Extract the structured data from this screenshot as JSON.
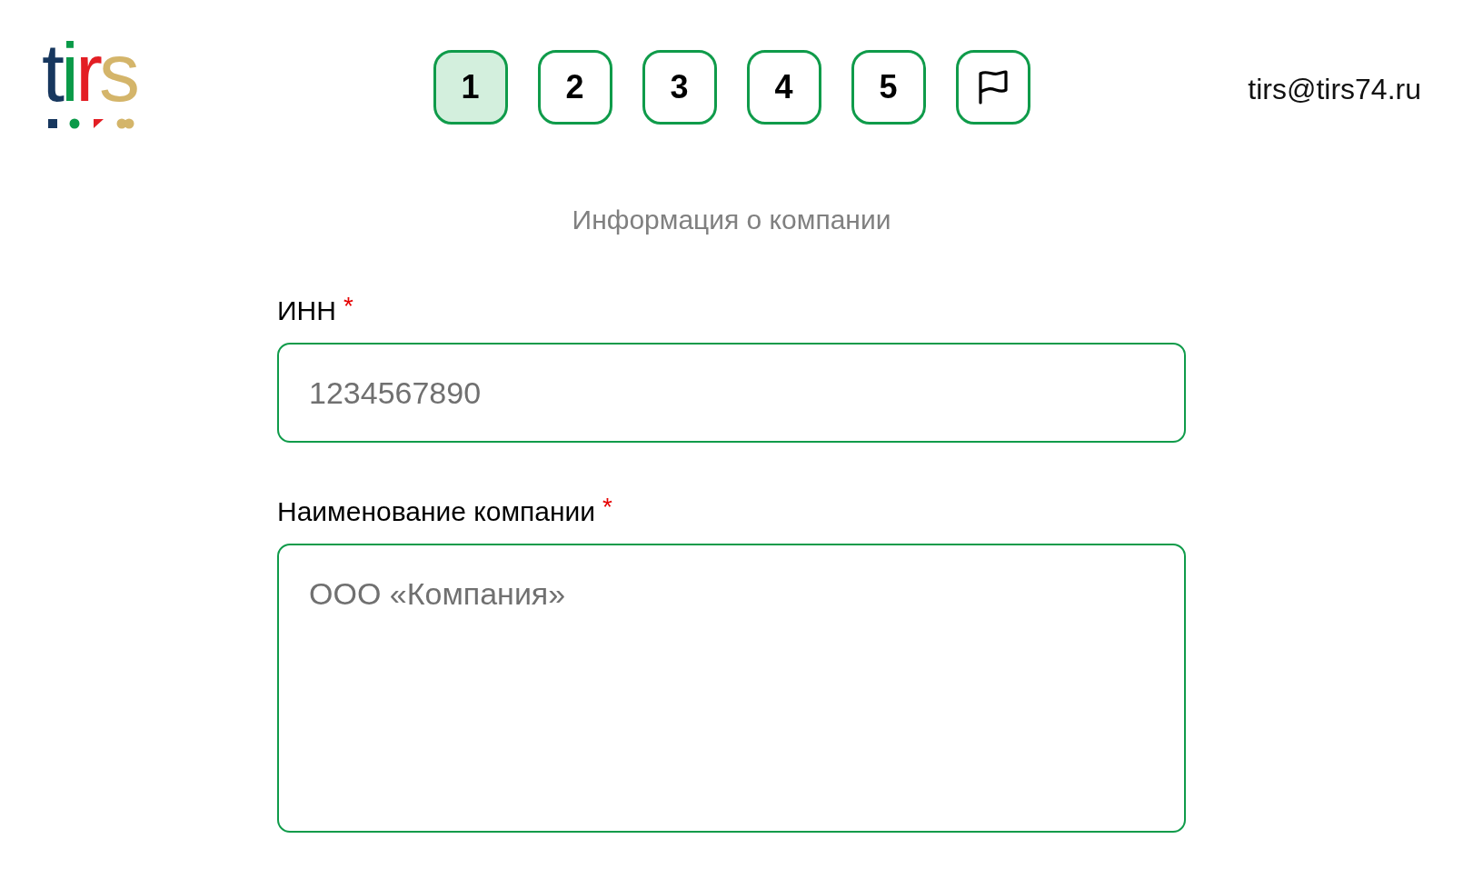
{
  "logo": {
    "text": "tirs"
  },
  "steps": [
    {
      "kind": "number",
      "label": "1",
      "selected": true
    },
    {
      "kind": "number",
      "label": "2",
      "selected": false
    },
    {
      "kind": "number",
      "label": "3",
      "selected": false
    },
    {
      "kind": "number",
      "label": "4",
      "selected": false
    },
    {
      "kind": "number",
      "label": "5",
      "selected": false
    },
    {
      "kind": "flag",
      "selected": false
    }
  ],
  "email": "tirs@tirs74.ru",
  "section_title": "Информация о компании",
  "fields": [
    {
      "kind": "input",
      "label": "ИНН",
      "required_mark": "*",
      "placeholder": "1234567890"
    },
    {
      "kind": "textarea",
      "label": "Наименование компании",
      "required_mark": "*",
      "placeholder": "ООО «Компания»"
    }
  ]
}
